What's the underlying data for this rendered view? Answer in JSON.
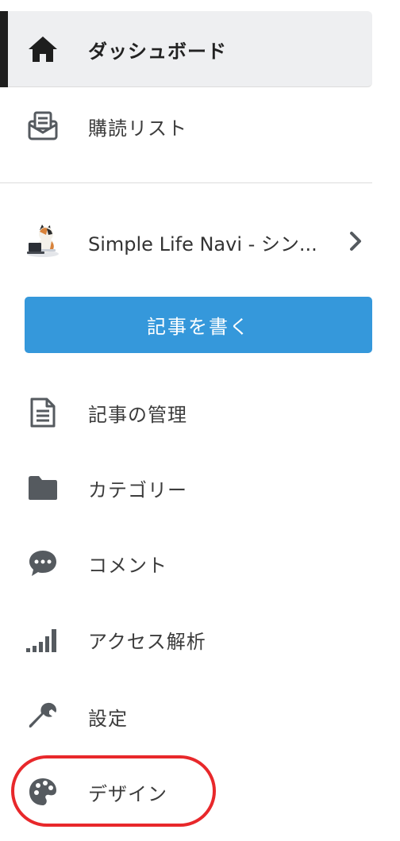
{
  "nav": {
    "dashboard": {
      "label": "ダッシュボード",
      "icon": "home-icon"
    },
    "subscriptions": {
      "label": "購読リスト",
      "icon": "mail-inbox-icon"
    },
    "blog": {
      "name": "Simple Life Navi - シン...",
      "avatar": "cat-avatar-icon",
      "icon": "chevron-right-icon"
    },
    "write_button": {
      "label": "記事を書く"
    },
    "items": [
      {
        "label": "記事の管理",
        "icon": "document-icon"
      },
      {
        "label": "カテゴリー",
        "icon": "folder-icon"
      },
      {
        "label": "コメント",
        "icon": "comment-icon"
      },
      {
        "label": "アクセス解析",
        "icon": "signal-bars-icon"
      },
      {
        "label": "設定",
        "icon": "wrench-icon"
      },
      {
        "label": "デザイン",
        "icon": "palette-icon"
      }
    ]
  },
  "colors": {
    "active_bg": "#eeeff1",
    "active_bar": "#1e1e1e",
    "button": "#3598db",
    "icon": "#555a5f",
    "highlight": "#e8282b"
  }
}
